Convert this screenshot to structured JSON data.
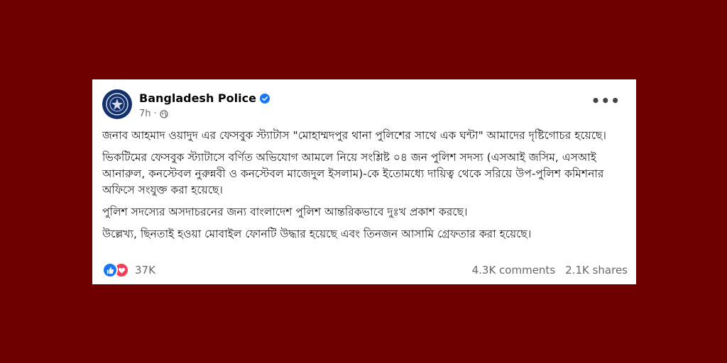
{
  "post": {
    "page_name": "Bangladesh Police",
    "time": "7h",
    "dot": "·",
    "more_label": "•••",
    "paragraphs": [
      "জনাব আহমাদ ওয়াদুদ এর ফেসবুক স্ট্যাটাস \"মোহাম্মদপুর থানা পুলিশের সাথে এক ঘন্টা\" আমাদের দৃষ্টিগোচর হয়েছে।",
      "ভিকটিমের ফেসবুক স্ট্যাটাসে বর্ণিত অভিযোগ আমলে নিয়ে সংশ্লিষ্ট ০৪ জন পুলিশ সদস্য (এসআই জসিম, এসআই আনারুল, কনস্টেবল নুরুন্নবী ও কনস্টেবল মাজেদুল ইসলাম)-কে ইতোমধ্যে দায়িত্ব থেকে সরিয়ে উপ-পুলিশ কমিশনার অফিসে সংযুক্ত করা হয়েছে।",
      "পুলিশ সদস্যের অসদাচরনের জন্য বাংলাদেশ পুলিশ আন্তরিকভাবে দুঃখ প্রকাশ করছে।",
      "উল্লেখ্য, ছিনতাই হওয়া মোবাইল ফোনটি উদ্ধার হয়েছে এবং তিনজন আসামি গ্রেফতার করা হয়েছে।"
    ],
    "reaction_count": "37K",
    "comments": "4.3K comments",
    "shares": "2.1K shares"
  },
  "colors": {
    "background": "#6e0000",
    "verified": "#1877f2",
    "like": "#1877f2",
    "love": "#f33e58"
  }
}
